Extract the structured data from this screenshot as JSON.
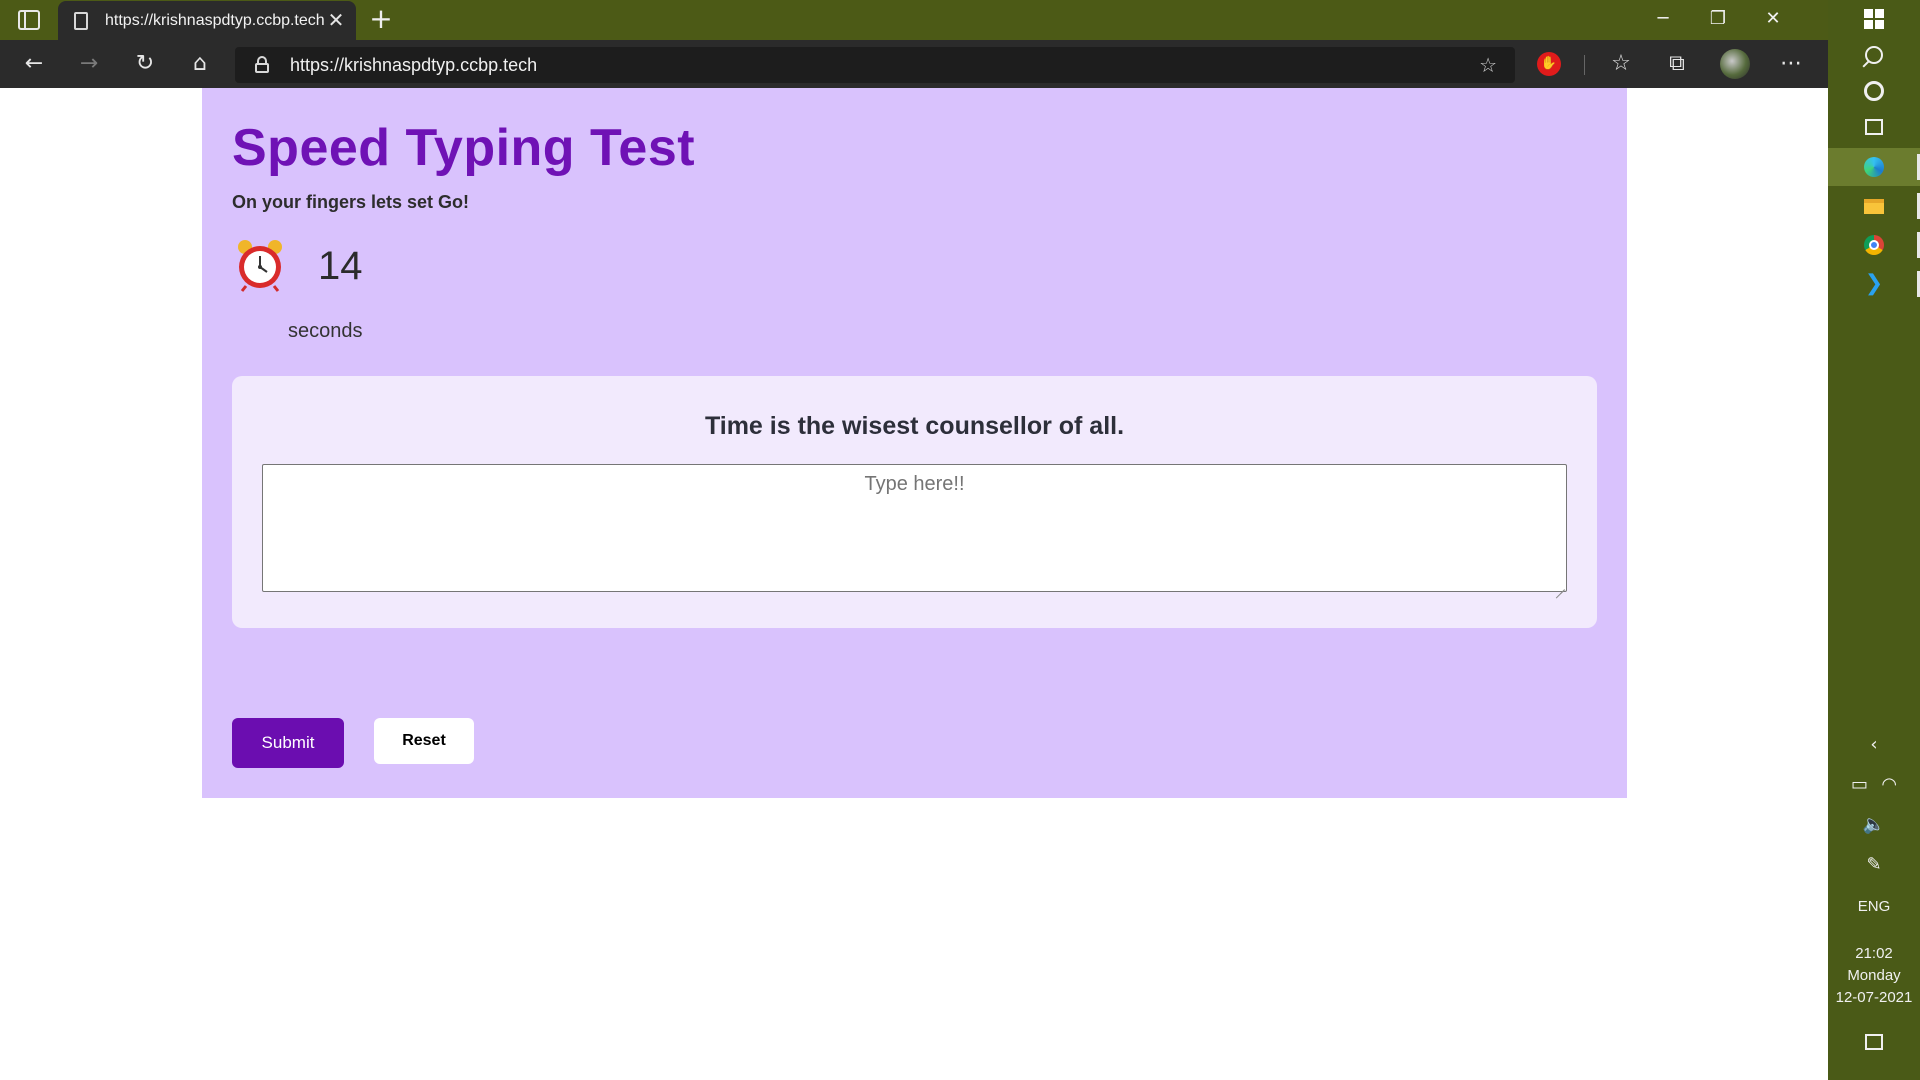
{
  "browser": {
    "tab_title": "https://krishnaspdtyp.ccbp.tech",
    "url": "https://krishnaspdtyp.ccbp.tech",
    "colors": {
      "tabbar": "#4c5a16",
      "toolbar": "#2b2b2b"
    }
  },
  "page": {
    "title": "Speed Typing Test",
    "subtitle": "On your fingers lets set Go!",
    "timer_value": "14",
    "timer_unit": "seconds",
    "quote": "Time is the wisest counsellor of all.",
    "input_placeholder": "Type here!!",
    "input_value": "",
    "submit_label": "Submit",
    "reset_label": "Reset",
    "colors": {
      "background": "#d9c2fd",
      "card": "#f2eafd",
      "heading": "#6f12b5",
      "submit": "#6b0db0"
    },
    "icons": {
      "timer": "alarm-clock-icon"
    }
  },
  "taskbar": {
    "language": "ENG",
    "time": "21:02",
    "day": "Monday",
    "date": "12-07-2021",
    "pinned": [
      "edge",
      "file-explorer",
      "chrome",
      "vscode"
    ]
  }
}
